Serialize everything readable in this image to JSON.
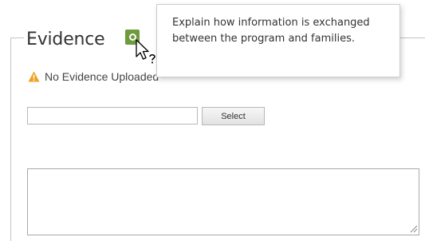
{
  "section": {
    "title": "Evidence",
    "status_text": "No Evidence Uploaded"
  },
  "help": {
    "tooltip_text": "Explain how information is exchanged between the program and families."
  },
  "upload": {
    "file_value": "",
    "select_label": "Select"
  },
  "notes": {
    "value": ""
  },
  "icons": {
    "help": "help-circle-icon",
    "warning": "warning-triangle-icon",
    "cursor": "help-cursor-icon",
    "resize": "resize-grip-icon"
  },
  "colors": {
    "help_button": "#6f9a3d",
    "warning": "#f0a020",
    "border": "#c4c4c4"
  }
}
